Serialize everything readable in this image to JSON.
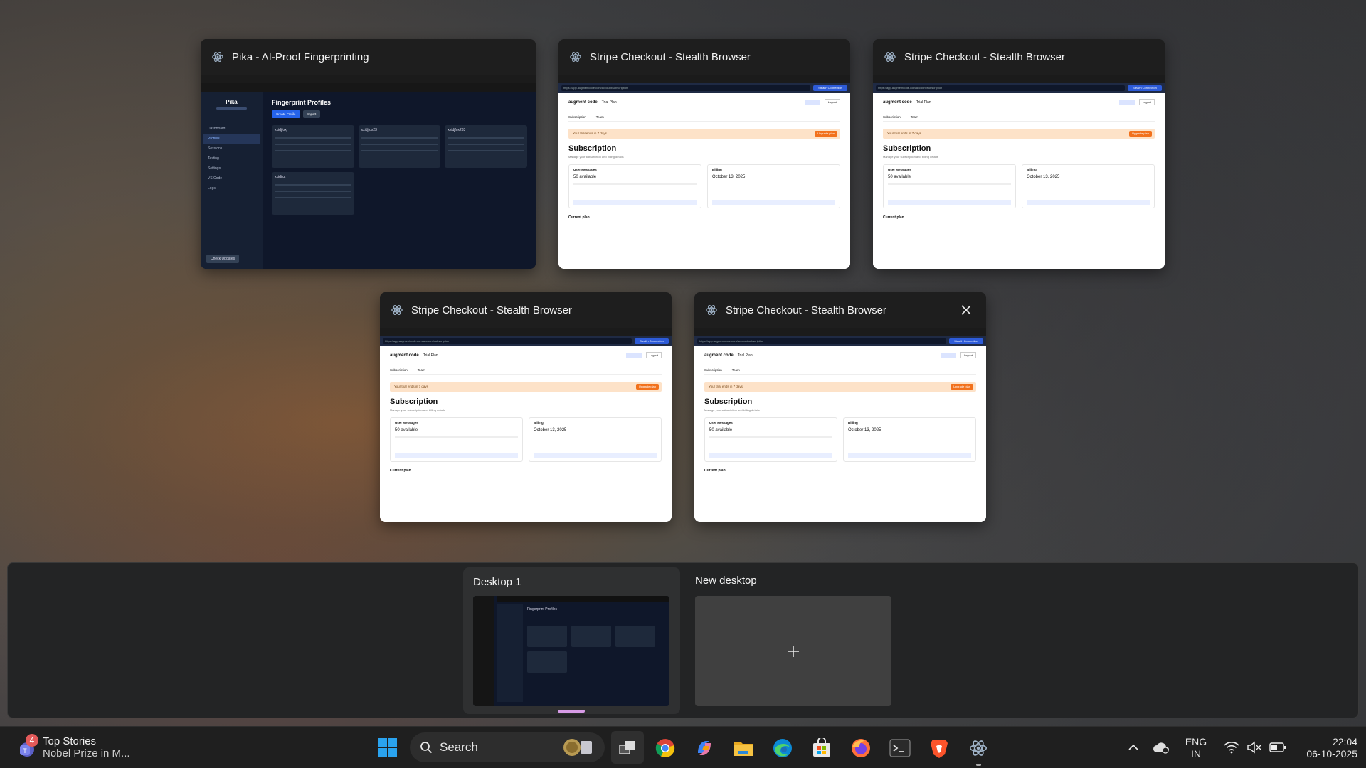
{
  "windows": [
    {
      "title": "Pika - AI-Proof Fingerprinting"
    },
    {
      "title": "Stripe Checkout - Stealth Browser"
    },
    {
      "title": "Stripe Checkout - Stealth Browser"
    },
    {
      "title": "Stripe Checkout - Stealth Browser"
    },
    {
      "title": "Stripe Checkout - Stealth Browser"
    }
  ],
  "pika_app": {
    "logo": "Pika",
    "heading": "Fingerprint Profiles",
    "create_button": "Create Profile",
    "import_button": "Import",
    "nav": [
      "Dashboard",
      "Profiles",
      "Sessions",
      "Testing",
      "Settings",
      "VS Code",
      "Logs"
    ],
    "check_updates": "Check Updates",
    "cards": [
      "xxidjfoxj",
      "xxidjfox23",
      "xxidjfox233",
      "xxidjlut"
    ]
  },
  "stripe_app": {
    "logo": "augment code",
    "plan_badge": "Trial Plan",
    "logout": "Logout",
    "tabs": [
      "Subscription",
      "Team"
    ],
    "banner": "Your trial ends in 7 days",
    "upgrade": "Upgrade plan",
    "heading": "Subscription",
    "subtitle": "Manage your subscription and billing details",
    "user_messages": "User Messages",
    "available": "50 available",
    "billing": "Billing",
    "date": "October 13, 2025",
    "current_plan": "Current plan",
    "url": "https://app.augmentcode.com/account/subscription",
    "connection": "Stealth Connection"
  },
  "desktops": {
    "desktop1_label": "Desktop 1",
    "new_desktop_label": "New desktop"
  },
  "taskbar": {
    "news_title": "Top Stories",
    "news_subtitle": "Nobel Prize in M...",
    "news_badge": "4",
    "search_label": "Search",
    "lang_top": "ENG",
    "lang_bottom": "IN",
    "time": "22:04",
    "date": "06-10-2025"
  }
}
